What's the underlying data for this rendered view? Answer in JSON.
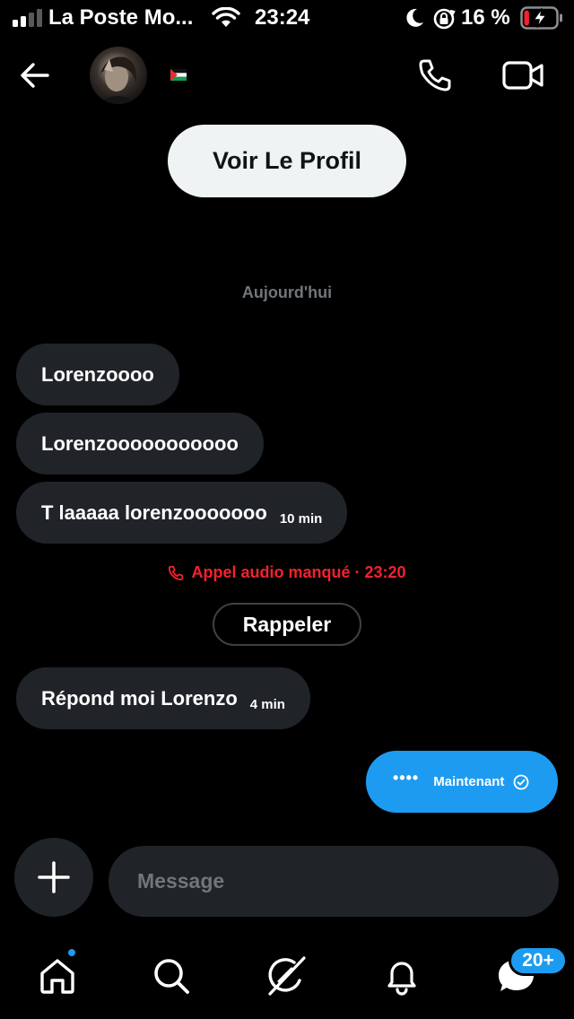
{
  "status_bar": {
    "carrier": "La Poste Mo...",
    "time": "23:24",
    "battery_percent": "16 %",
    "signal_bars_active": 2,
    "signal_bars_total": 4,
    "battery_level": 0.16,
    "icons": [
      "signal-icon",
      "wifi-icon",
      "moon-icon",
      "rotation-lock-icon",
      "battery-charging-icon"
    ]
  },
  "header": {
    "back_icon": "arrow-left-icon",
    "avatar_icon": "avatar",
    "flag_icon": "palestine-flag-icon",
    "call_icon": "phone-icon",
    "video_icon": "video-camera-icon"
  },
  "profile_button": {
    "label": "Voir Le Profil"
  },
  "date_separator": "Aujourd'hui",
  "messages": [
    {
      "text": "Lorenzoooo",
      "time": ""
    },
    {
      "text": "Lorenzooooooooooo",
      "time": ""
    },
    {
      "text": "T laaaaa lorenzooooooo",
      "time": "10 min"
    }
  ],
  "missed_call": {
    "text": "Appel audio manqué · 23:20",
    "icon": "phone-icon"
  },
  "callback_button": {
    "label": "Rappeler"
  },
  "messages_after": [
    {
      "text": "Répond moi Lorenzo",
      "time": "4 min"
    }
  ],
  "outgoing": {
    "dots": "••••",
    "time": "Maintenant",
    "status_icon": "sent-check-icon"
  },
  "composer": {
    "placeholder": "Message",
    "add_icon": "plus-icon"
  },
  "tab_bar": {
    "items": [
      "home-icon",
      "search-icon",
      "grok-icon",
      "bell-icon",
      "messages-icon"
    ],
    "messages_badge": "20+"
  },
  "colors": {
    "accent": "#1d9bf0",
    "bubble": "#202327",
    "missed": "#f4212e",
    "muted": "#71767b",
    "battery_low": "#f4212e"
  }
}
